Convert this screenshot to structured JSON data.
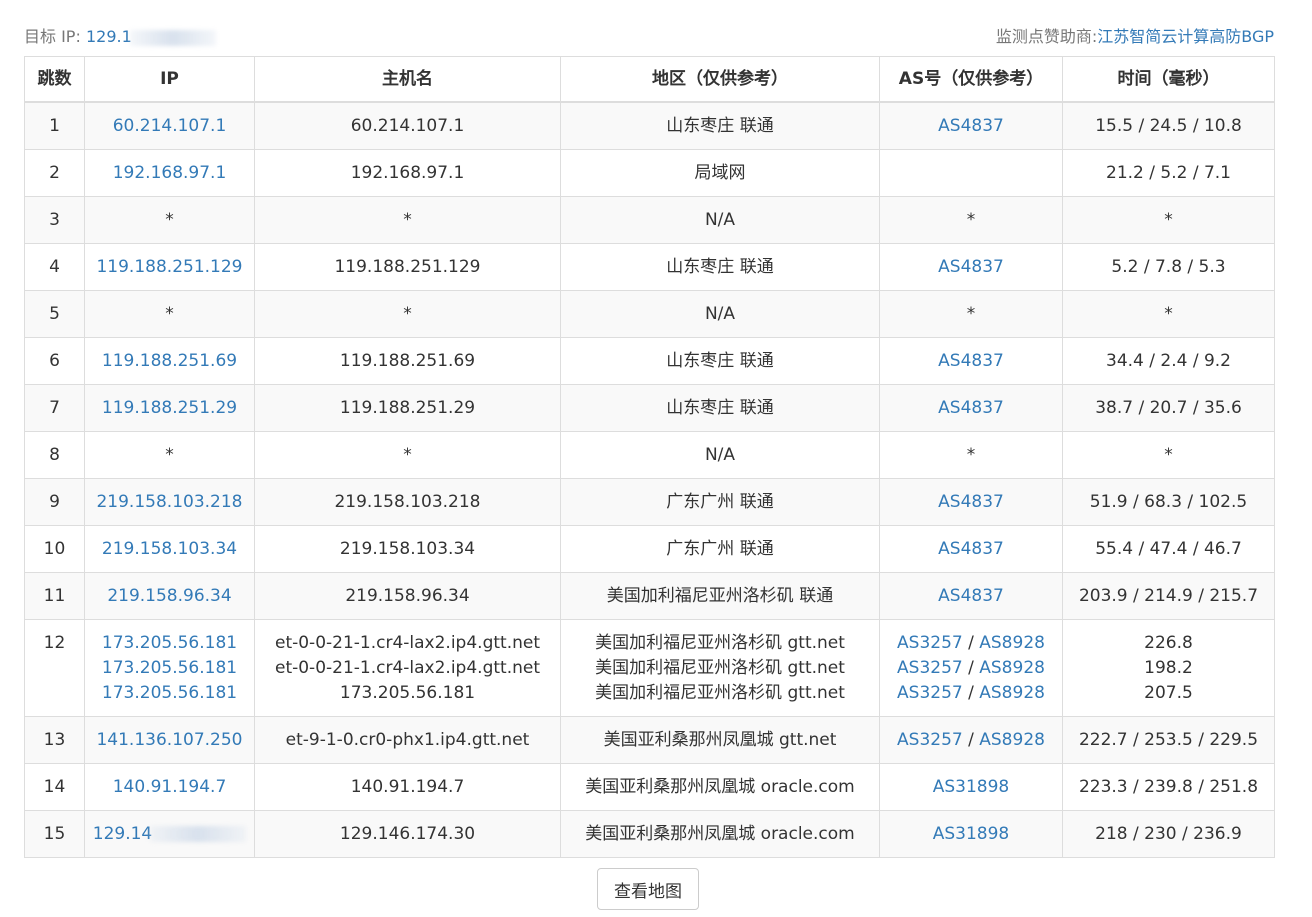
{
  "header": {
    "target_label": "目标 IP:",
    "target_ip_visible": "129.1",
    "sponsor_label": "监测点赞助商:",
    "sponsor_name": "江苏智简云计算高防BGP"
  },
  "table": {
    "columns": [
      "跳数",
      "IP",
      "主机名",
      "地区（仅供参考）",
      "AS号（仅供参考）",
      "时间（毫秒）"
    ],
    "rows": [
      {
        "hop": "1",
        "ip": "60.214.107.1",
        "host": "60.214.107.1",
        "region": "山东枣庄 联通",
        "as1": "AS4837",
        "as2": "",
        "time": "15.5 / 24.5 / 10.8"
      },
      {
        "hop": "2",
        "ip": "192.168.97.1",
        "host": "192.168.97.1",
        "region": "局域网",
        "as1": "",
        "as2": "",
        "time": "21.2 / 5.2 / 7.1"
      },
      {
        "hop": "3",
        "ip": "*",
        "host": "*",
        "region": "N/A",
        "as1": "*",
        "as2": "",
        "time": "*"
      },
      {
        "hop": "4",
        "ip": "119.188.251.129",
        "host": "119.188.251.129",
        "region": "山东枣庄 联通",
        "as1": "AS4837",
        "as2": "",
        "time": "5.2 / 7.8 / 5.3"
      },
      {
        "hop": "5",
        "ip": "*",
        "host": "*",
        "region": "N/A",
        "as1": "*",
        "as2": "",
        "time": "*"
      },
      {
        "hop": "6",
        "ip": "119.188.251.69",
        "host": "119.188.251.69",
        "region": "山东枣庄 联通",
        "as1": "AS4837",
        "as2": "",
        "time": "34.4 / 2.4 / 9.2"
      },
      {
        "hop": "7",
        "ip": "119.188.251.29",
        "host": "119.188.251.29",
        "region": "山东枣庄 联通",
        "as1": "AS4837",
        "as2": "",
        "time": "38.7 / 20.7 / 35.6"
      },
      {
        "hop": "8",
        "ip": "*",
        "host": "*",
        "region": "N/A",
        "as1": "*",
        "as2": "",
        "time": "*"
      },
      {
        "hop": "9",
        "ip": "219.158.103.218",
        "host": "219.158.103.218",
        "region": "广东广州 联通",
        "as1": "AS4837",
        "as2": "",
        "time": "51.9 / 68.3 / 102.5"
      },
      {
        "hop": "10",
        "ip": "219.158.103.34",
        "host": "219.158.103.34",
        "region": "广东广州 联通",
        "as1": "AS4837",
        "as2": "",
        "time": "55.4 / 47.4 / 46.7"
      },
      {
        "hop": "11",
        "ip": "219.158.96.34",
        "host": "219.158.96.34",
        "region": "美国加利福尼亚州洛杉矶 联通",
        "as1": "AS4837",
        "as2": "",
        "time": "203.9 / 214.9 / 215.7"
      },
      {
        "hop": "12",
        "ip": "173.205.56.181",
        "host": "et-0-0-21-1.cr4-lax2.ip4.gtt.net",
        "region": "美国加利福尼亚州洛杉矶 gtt.net",
        "as1": "AS3257",
        "as2": "AS8928",
        "time": "226.8",
        "ip_2": "173.205.56.181",
        "host_2": "et-0-0-21-1.cr4-lax2.ip4.gtt.net",
        "region_2": "美国加利福尼亚州洛杉矶 gtt.net",
        "as1_2": "AS3257",
        "as2_2": "AS8928",
        "time_2": "198.2",
        "ip_3": "173.205.56.181",
        "host_3": "173.205.56.181",
        "region_3": "美国加利福尼亚州洛杉矶 gtt.net",
        "as1_3": "AS3257",
        "as2_3": "AS8928",
        "time_3": "207.5"
      },
      {
        "hop": "13",
        "ip": "141.136.107.250",
        "host": "et-9-1-0.cr0-phx1.ip4.gtt.net",
        "region": "美国亚利桑那州凤凰城 gtt.net",
        "as1": "AS3257",
        "as2": "AS8928",
        "time": "222.7 / 253.5 / 229.5"
      },
      {
        "hop": "14",
        "ip": "140.91.194.7",
        "host": "140.91.194.7",
        "region": "美国亚利桑那州凤凰城 oracle.com",
        "as1": "AS31898",
        "as2": "",
        "time": "223.3 / 239.8 / 251.8"
      },
      {
        "hop": "15",
        "ip": "129.14",
        "host": "129.146.174.30",
        "region": "美国亚利桑那州凤凰城 oracle.com",
        "as1": "AS31898",
        "as2": "",
        "time": "218 / 230 / 236.9"
      }
    ]
  },
  "map_button_label": "查看地图",
  "colors": {
    "link": "#337ab7",
    "border": "#dddddd",
    "stripe": "#f9f9f9"
  }
}
